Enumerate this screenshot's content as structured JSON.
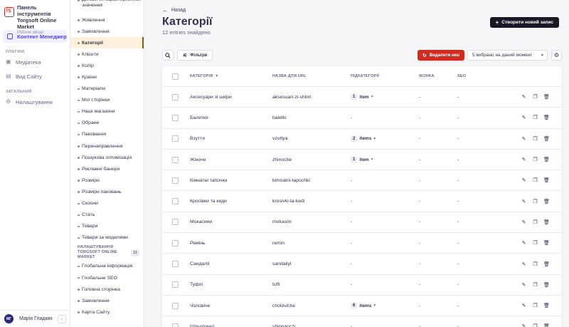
{
  "brand": {
    "title": "Панель інструментів Torgsoft Online Market",
    "subtitle": "Робоче місце",
    "logo_text": "TS"
  },
  "mainnav": {
    "active": {
      "label": "Контент Менеджер",
      "icon": "feather-icon"
    },
    "sections": [
      {
        "title": "ПЛАГІНИ",
        "items": [
          {
            "label": "Медіатека",
            "icon": "image-icon"
          }
        ]
      },
      {
        "title": "",
        "items": [
          {
            "label": "Вид Сайту",
            "icon": "layout-icon"
          }
        ]
      },
      {
        "title": "ЗАГАЛЬНИЙ",
        "items": [
          {
            "label": "Налаштування",
            "icon": "gear-icon"
          }
        ]
      }
    ],
    "user": {
      "initials": "MГ",
      "name": "Марія Гладких"
    }
  },
  "subnav": {
    "items_top": [
      "Динамічні характеристики значення",
      "Живлення",
      "Замовлення",
      "Категорії",
      "Клієнти",
      "Колір",
      "Країни",
      "Матеріали",
      "Мої сторінки",
      "Наші магазини",
      "Обране",
      "Паковання",
      "Перенаправлення",
      "Пошукова оптимізація",
      "Рекламні банери",
      "Розміри",
      "Розміри паковань",
      "Сезони",
      "Стать",
      "Товари",
      "Товари за моделями"
    ],
    "active_index": 3,
    "section": {
      "title_line1": "НАЛАШТУВАННЯ",
      "title_line2": "TORGSOFT ONLINE MARKET",
      "count": "11"
    },
    "items_bottom": [
      "Глобальна інформація",
      "Глобальне SEO",
      "Головна сторінка",
      "Замовлення",
      "Карта Сайту"
    ]
  },
  "header": {
    "back_label": "Назад",
    "title": "Категорії",
    "subtitle": "12 entries знайдено",
    "create_label": "Створити новий запис"
  },
  "toolbar": {
    "filters_label": "Фільтри",
    "clear_cache_label": "Видалити кеш",
    "selected_label": "5 вибрано на даний момент"
  },
  "table": {
    "headers": {
      "category": "КАТЕГОРІЯ",
      "url": "НАЗВА ДЛЯ URL",
      "sub": "ПІДКАТЕГОРІЇ",
      "icon": "ІКОНКА",
      "seo": "SEO"
    },
    "rows": [
      {
        "cat": "Аксесуари зі шкіри",
        "url": "aksesuari-zi-shkiri",
        "sub_count": "1",
        "sub_label": "item",
        "icon": "-",
        "seo": "-"
      },
      {
        "cat": "Балетки",
        "url": "baletki",
        "sub_count": "",
        "sub_label": "-",
        "icon": "-",
        "seo": "-"
      },
      {
        "cat": "Взуття",
        "url": "vzuttya",
        "sub_count": "2",
        "sub_label": "items",
        "icon": "-",
        "seo": "-"
      },
      {
        "cat": "Жіноче",
        "url": "zhinoche",
        "sub_count": "1",
        "sub_label": "item",
        "icon": "-",
        "seo": "-"
      },
      {
        "cat": "Кімнатні тапочки",
        "url": "kimnatni-tapochki",
        "sub_count": "",
        "sub_label": "-",
        "icon": "-",
        "seo": "-"
      },
      {
        "cat": "Кросівки та кеди",
        "url": "krosivki-ta-kedi",
        "sub_count": "",
        "sub_label": "-",
        "icon": "-",
        "seo": "-"
      },
      {
        "cat": "Мокасини",
        "url": "mokasini",
        "sub_count": "",
        "sub_label": "-",
        "icon": "-",
        "seo": "-"
      },
      {
        "cat": "Ремінь",
        "url": "remin",
        "sub_count": "",
        "sub_label": "-",
        "icon": "-",
        "seo": "-"
      },
      {
        "cat": "Сандалії",
        "url": "sandaliyi",
        "sub_count": "",
        "sub_label": "-",
        "icon": "-",
        "seo": "-"
      },
      {
        "cat": "Туфлі",
        "url": "tufli",
        "sub_count": "",
        "sub_label": "-",
        "icon": "-",
        "seo": "-"
      },
      {
        "cat": "Чоловіче",
        "url": "choloviche",
        "sub_count": "6",
        "sub_label": "items",
        "icon": "-",
        "seo": "-"
      },
      {
        "cat": "Шльопанці",
        "url": "shlopanczi",
        "sub_count": "",
        "sub_label": "-",
        "icon": "-",
        "seo": "-"
      }
    ]
  },
  "colors": {
    "accent": "#4945ff",
    "danger": "#d02b20",
    "active_bg": "#fdf0dc"
  }
}
